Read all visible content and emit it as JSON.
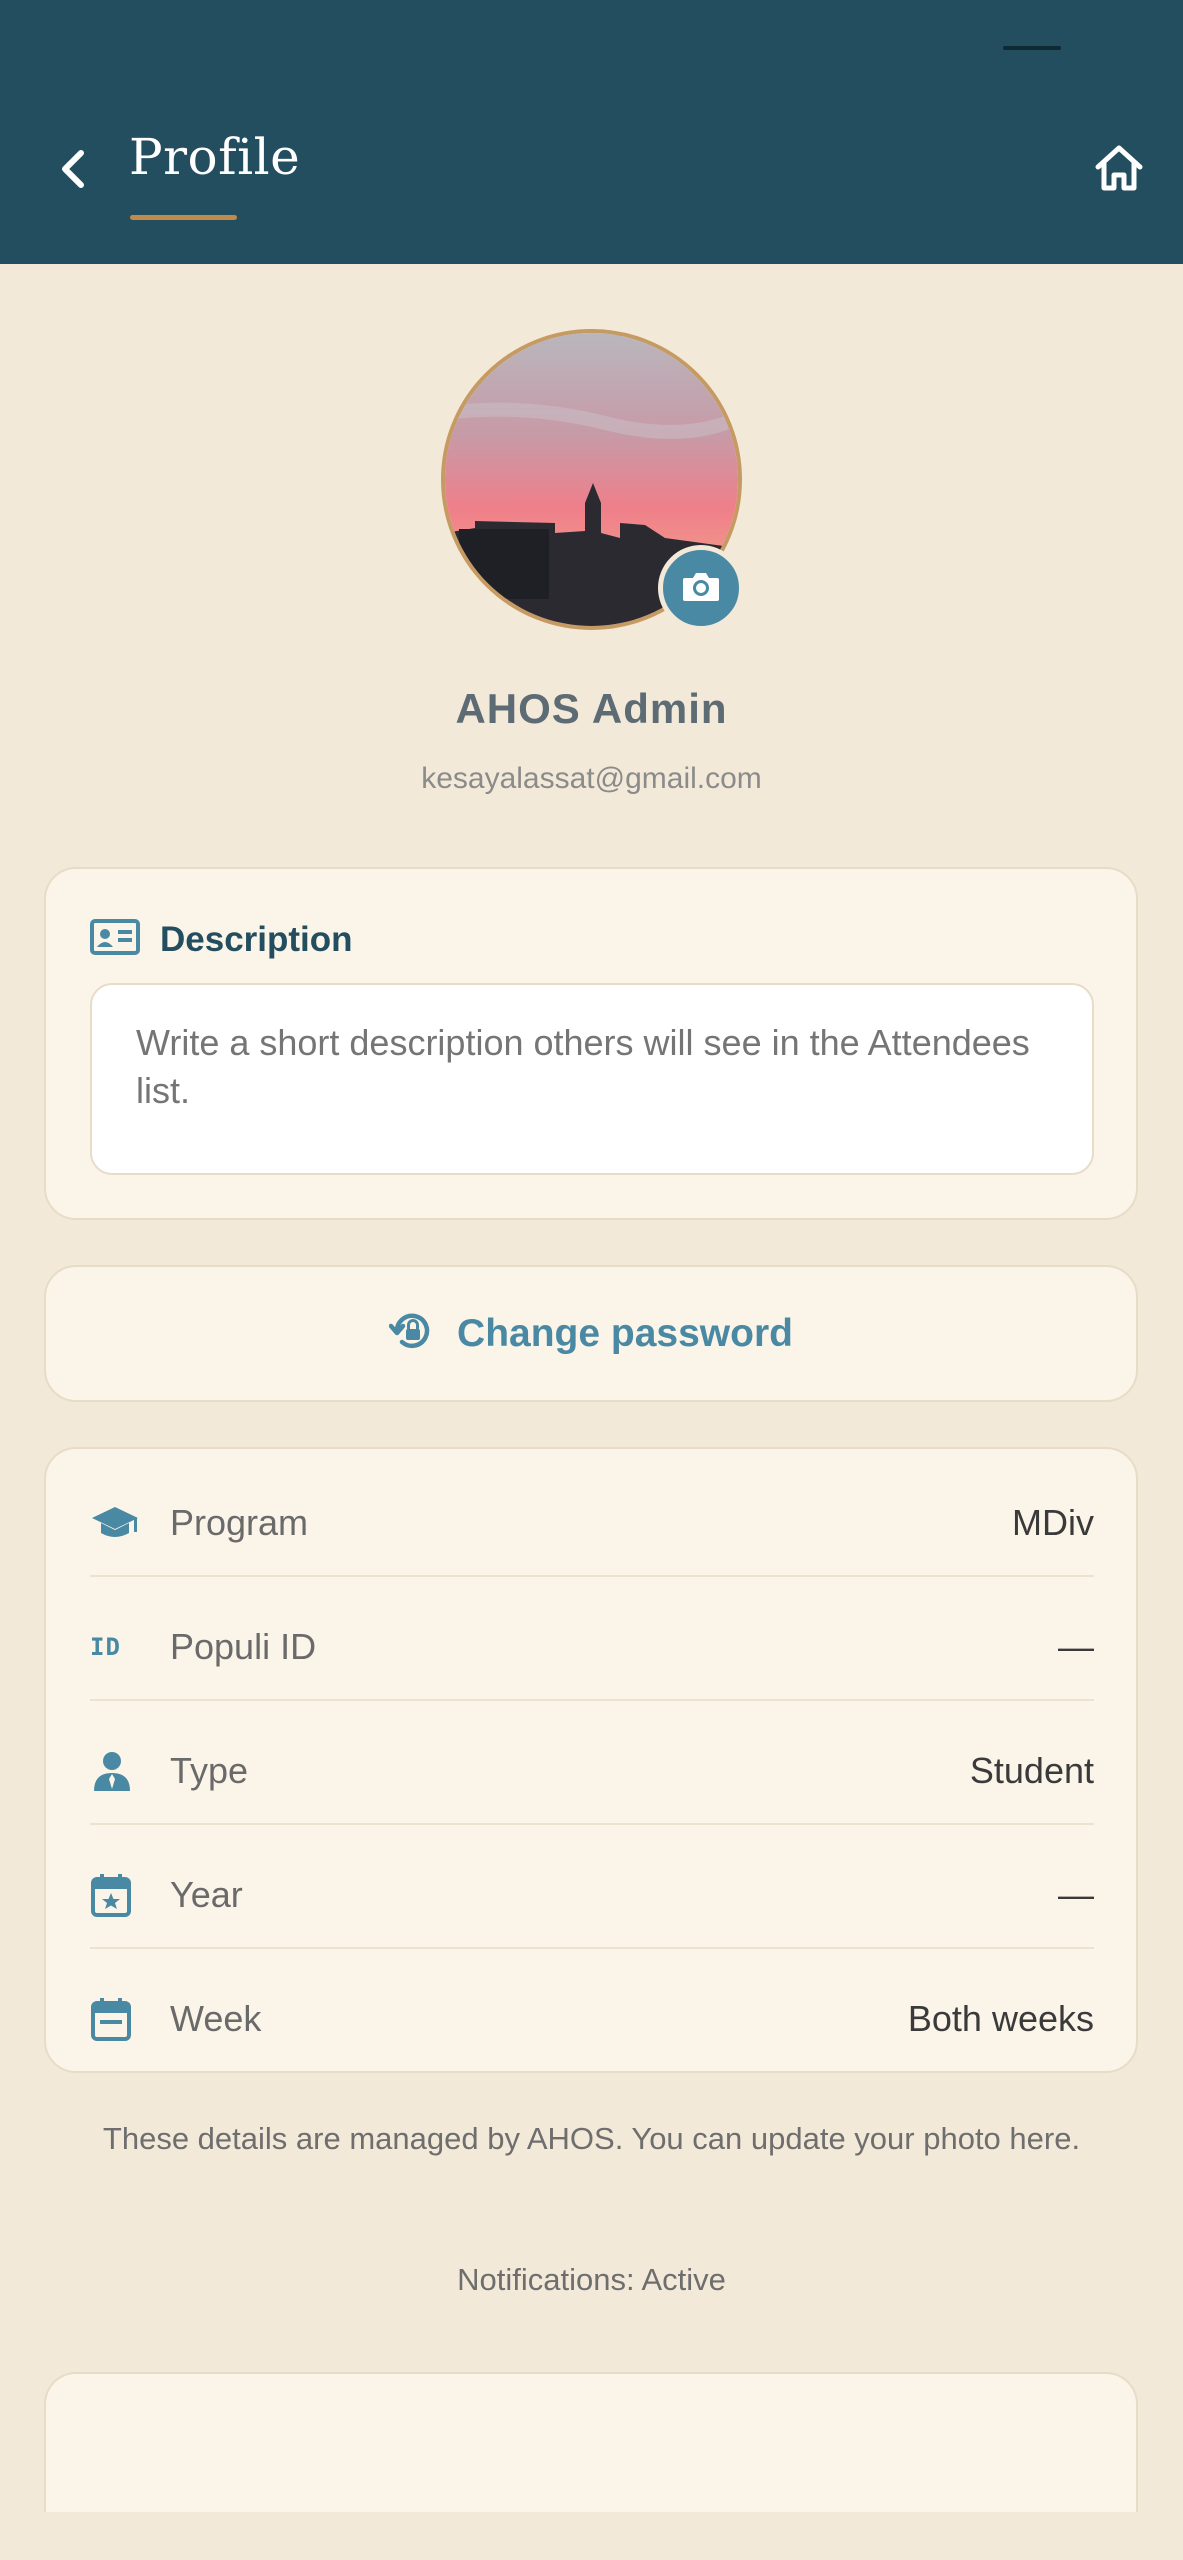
{
  "header": {
    "title": "Profile",
    "back_icon": "chevron-left-icon",
    "home_icon": "home-icon"
  },
  "profile": {
    "name": "AHOS Admin",
    "email": "kesayalassat@gmail.com",
    "camera_icon": "camera-icon"
  },
  "description": {
    "title": "Description",
    "placeholder": "Write a short description others will see in the Attendees list."
  },
  "password": {
    "label": "Change password"
  },
  "details": [
    {
      "icon": "graduation-cap-icon",
      "label": "Program",
      "value": "MDiv"
    },
    {
      "icon": "id-icon",
      "label": "Populi ID",
      "value": "—"
    },
    {
      "icon": "user-tie-icon",
      "label": "Type",
      "value": "Student"
    },
    {
      "icon": "calendar-star-icon",
      "label": "Year",
      "value": "—"
    },
    {
      "icon": "calendar-icon",
      "label": "Week",
      "value": "Both weeks"
    }
  ],
  "footnote": "These details are managed by AHOS. You can update your photo here.",
  "notifications": "Notifications: Active",
  "colors": {
    "header": "#234e5f",
    "accent": "#4a89a3",
    "background": "#f3e9d9",
    "underline": "#c08a4a"
  }
}
